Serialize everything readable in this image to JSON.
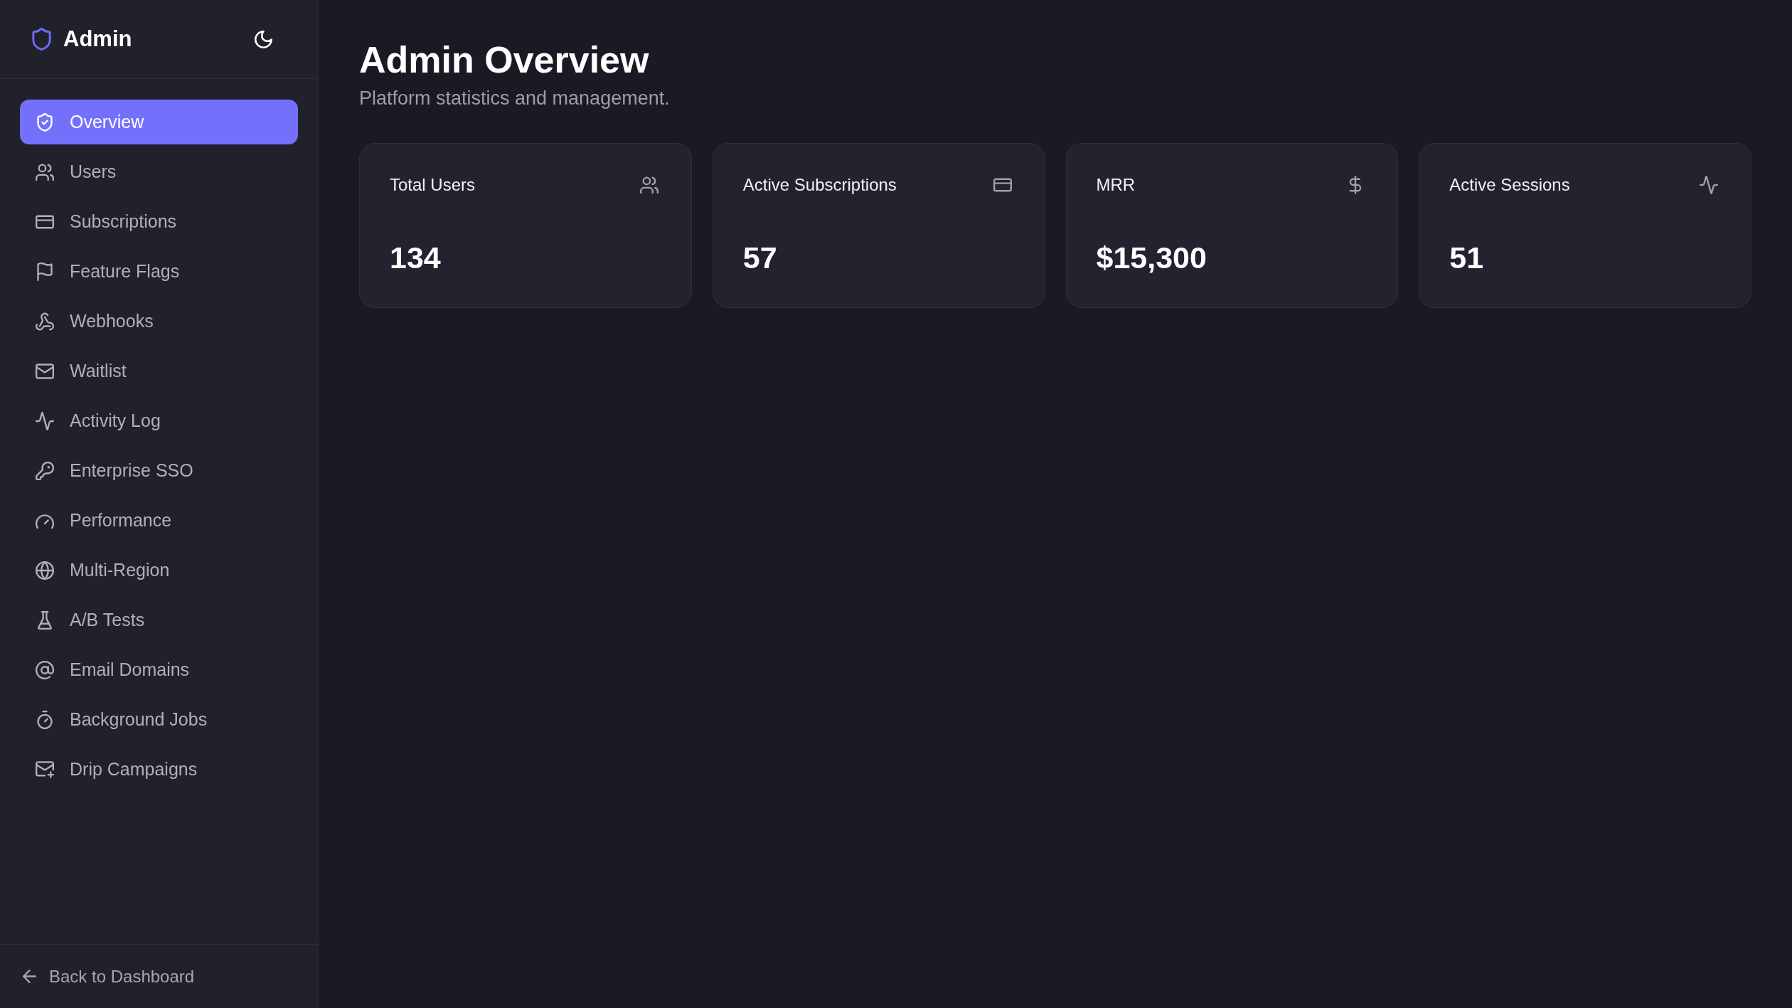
{
  "sidebar": {
    "brand": "Admin",
    "items": [
      {
        "label": "Overview",
        "selected": true
      },
      {
        "label": "Users",
        "selected": false
      },
      {
        "label": "Subscriptions",
        "selected": false
      },
      {
        "label": "Feature Flags",
        "selected": false
      },
      {
        "label": "Webhooks",
        "selected": false
      },
      {
        "label": "Waitlist",
        "selected": false
      },
      {
        "label": "Activity Log",
        "selected": false
      },
      {
        "label": "Enterprise SSO",
        "selected": false
      },
      {
        "label": "Performance",
        "selected": false
      },
      {
        "label": "Multi-Region",
        "selected": false
      },
      {
        "label": "A/B Tests",
        "selected": false
      },
      {
        "label": "Email Domains",
        "selected": false
      },
      {
        "label": "Background Jobs",
        "selected": false
      },
      {
        "label": "Drip Campaigns",
        "selected": false
      }
    ],
    "back_link": "Back to Dashboard"
  },
  "page": {
    "title": "Admin Overview",
    "subtitle": "Platform statistics and management."
  },
  "stats": [
    {
      "label": "Total Users",
      "value": "134"
    },
    {
      "label": "Active Subscriptions",
      "value": "57"
    },
    {
      "label": "MRR",
      "value": "$15,300"
    },
    {
      "label": "Active Sessions",
      "value": "51"
    }
  ]
}
